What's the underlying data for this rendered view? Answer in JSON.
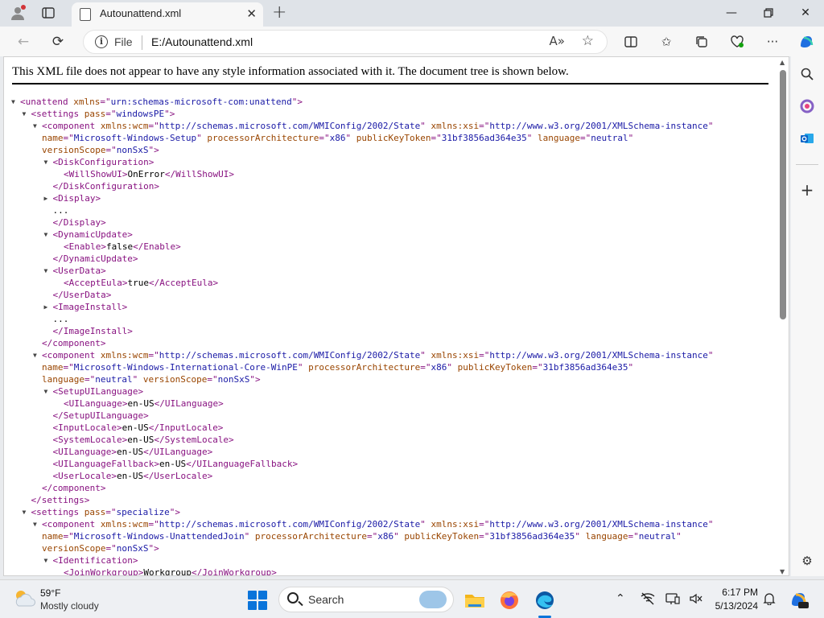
{
  "browser": {
    "tab_title": "Autounattend.xml",
    "address_scheme": "File",
    "address_url": "E:/Autounattend.xml",
    "read_aloud_glyph": "A»"
  },
  "page": {
    "banner": "This XML file does not appear to have any style information associated with it. The document tree is shown below."
  },
  "xml_lines": [
    {
      "indent": 0,
      "toggle": "open",
      "parts": [
        [
          "t",
          "<unattend "
        ],
        [
          "a",
          "xmlns"
        ],
        [
          "t",
          "=\""
        ],
        [
          "v",
          "urn:schemas-microsoft-com:unattend"
        ],
        [
          "t",
          "\">"
        ]
      ]
    },
    {
      "indent": 1,
      "toggle": "open",
      "parts": [
        [
          "t",
          "<settings "
        ],
        [
          "a",
          "pass"
        ],
        [
          "t",
          "=\""
        ],
        [
          "v",
          "windowsPE"
        ],
        [
          "t",
          "\">"
        ]
      ]
    },
    {
      "indent": 2,
      "toggle": "open",
      "parts": [
        [
          "t",
          "<component "
        ],
        [
          "a",
          "xmlns:wcm"
        ],
        [
          "t",
          "=\""
        ],
        [
          "v",
          "http://schemas.microsoft.com/WMIConfig/2002/State"
        ],
        [
          "t",
          "\" "
        ],
        [
          "a",
          "xmlns:xsi"
        ],
        [
          "t",
          "=\""
        ],
        [
          "v",
          "http://www.w3.org/2001/XMLSchema-instance"
        ],
        [
          "t",
          "\""
        ]
      ]
    },
    {
      "indent": 2,
      "cont": true,
      "parts": [
        [
          "a",
          "name"
        ],
        [
          "t",
          "=\""
        ],
        [
          "v",
          "Microsoft-Windows-Setup"
        ],
        [
          "t",
          "\" "
        ],
        [
          "a",
          "processorArchitecture"
        ],
        [
          "t",
          "=\""
        ],
        [
          "v",
          "x86"
        ],
        [
          "t",
          "\" "
        ],
        [
          "a",
          "publicKeyToken"
        ],
        [
          "t",
          "=\""
        ],
        [
          "v",
          "31bf3856ad364e35"
        ],
        [
          "t",
          "\" "
        ],
        [
          "a",
          "language"
        ],
        [
          "t",
          "=\""
        ],
        [
          "v",
          "neutral"
        ],
        [
          "t",
          "\""
        ]
      ]
    },
    {
      "indent": 2,
      "cont": true,
      "parts": [
        [
          "a",
          "versionScope"
        ],
        [
          "t",
          "=\""
        ],
        [
          "v",
          "nonSxS"
        ],
        [
          "t",
          "\">"
        ]
      ]
    },
    {
      "indent": 3,
      "toggle": "open",
      "parts": [
        [
          "t",
          "<DiskConfiguration>"
        ]
      ]
    },
    {
      "indent": 4,
      "parts": [
        [
          "t",
          "<WillShowUI>"
        ],
        [
          "x",
          "OnError"
        ],
        [
          "t",
          "</WillShowUI>"
        ]
      ]
    },
    {
      "indent": 3,
      "parts": [
        [
          "t",
          "</DiskConfiguration>"
        ]
      ]
    },
    {
      "indent": 3,
      "toggle": "closed",
      "parts": [
        [
          "t",
          "<Display>"
        ]
      ]
    },
    {
      "indent": 3,
      "parts": [
        [
          "x",
          "..."
        ]
      ]
    },
    {
      "indent": 3,
      "parts": [
        [
          "t",
          "</Display>"
        ]
      ]
    },
    {
      "indent": 3,
      "toggle": "open",
      "parts": [
        [
          "t",
          "<DynamicUpdate>"
        ]
      ]
    },
    {
      "indent": 4,
      "parts": [
        [
          "t",
          "<Enable>"
        ],
        [
          "x",
          "false"
        ],
        [
          "t",
          "</Enable>"
        ]
      ]
    },
    {
      "indent": 3,
      "parts": [
        [
          "t",
          "</DynamicUpdate>"
        ]
      ]
    },
    {
      "indent": 3,
      "toggle": "open",
      "parts": [
        [
          "t",
          "<UserData>"
        ]
      ]
    },
    {
      "indent": 4,
      "parts": [
        [
          "t",
          "<AcceptEula>"
        ],
        [
          "x",
          "true"
        ],
        [
          "t",
          "</AcceptEula>"
        ]
      ]
    },
    {
      "indent": 3,
      "parts": [
        [
          "t",
          "</UserData>"
        ]
      ]
    },
    {
      "indent": 3,
      "toggle": "closed",
      "parts": [
        [
          "t",
          "<ImageInstall>"
        ]
      ]
    },
    {
      "indent": 3,
      "parts": [
        [
          "x",
          "..."
        ]
      ]
    },
    {
      "indent": 3,
      "parts": [
        [
          "t",
          "</ImageInstall>"
        ]
      ]
    },
    {
      "indent": 2,
      "parts": [
        [
          "t",
          "</component>"
        ]
      ]
    },
    {
      "indent": 2,
      "toggle": "open",
      "parts": [
        [
          "t",
          "<component "
        ],
        [
          "a",
          "xmlns:wcm"
        ],
        [
          "t",
          "=\""
        ],
        [
          "v",
          "http://schemas.microsoft.com/WMIConfig/2002/State"
        ],
        [
          "t",
          "\" "
        ],
        [
          "a",
          "xmlns:xsi"
        ],
        [
          "t",
          "=\""
        ],
        [
          "v",
          "http://www.w3.org/2001/XMLSchema-instance"
        ],
        [
          "t",
          "\""
        ]
      ]
    },
    {
      "indent": 2,
      "cont": true,
      "parts": [
        [
          "a",
          "name"
        ],
        [
          "t",
          "=\""
        ],
        [
          "v",
          "Microsoft-Windows-International-Core-WinPE"
        ],
        [
          "t",
          "\" "
        ],
        [
          "a",
          "processorArchitecture"
        ],
        [
          "t",
          "=\""
        ],
        [
          "v",
          "x86"
        ],
        [
          "t",
          "\" "
        ],
        [
          "a",
          "publicKeyToken"
        ],
        [
          "t",
          "=\""
        ],
        [
          "v",
          "31bf3856ad364e35"
        ],
        [
          "t",
          "\""
        ]
      ]
    },
    {
      "indent": 2,
      "cont": true,
      "parts": [
        [
          "a",
          "language"
        ],
        [
          "t",
          "=\""
        ],
        [
          "v",
          "neutral"
        ],
        [
          "t",
          "\" "
        ],
        [
          "a",
          "versionScope"
        ],
        [
          "t",
          "=\""
        ],
        [
          "v",
          "nonSxS"
        ],
        [
          "t",
          "\">"
        ]
      ]
    },
    {
      "indent": 3,
      "toggle": "open",
      "parts": [
        [
          "t",
          "<SetupUILanguage>"
        ]
      ]
    },
    {
      "indent": 4,
      "parts": [
        [
          "t",
          "<UILanguage>"
        ],
        [
          "x",
          "en-US"
        ],
        [
          "t",
          "</UILanguage>"
        ]
      ]
    },
    {
      "indent": 3,
      "parts": [
        [
          "t",
          "</SetupUILanguage>"
        ]
      ]
    },
    {
      "indent": 3,
      "parts": [
        [
          "t",
          "<InputLocale>"
        ],
        [
          "x",
          "en-US"
        ],
        [
          "t",
          "</InputLocale>"
        ]
      ]
    },
    {
      "indent": 3,
      "parts": [
        [
          "t",
          "<SystemLocale>"
        ],
        [
          "x",
          "en-US"
        ],
        [
          "t",
          "</SystemLocale>"
        ]
      ]
    },
    {
      "indent": 3,
      "parts": [
        [
          "t",
          "<UILanguage>"
        ],
        [
          "x",
          "en-US"
        ],
        [
          "t",
          "</UILanguage>"
        ]
      ]
    },
    {
      "indent": 3,
      "parts": [
        [
          "t",
          "<UILanguageFallback>"
        ],
        [
          "x",
          "en-US"
        ],
        [
          "t",
          "</UILanguageFallback>"
        ]
      ]
    },
    {
      "indent": 3,
      "parts": [
        [
          "t",
          "<UserLocale>"
        ],
        [
          "x",
          "en-US"
        ],
        [
          "t",
          "</UserLocale>"
        ]
      ]
    },
    {
      "indent": 2,
      "parts": [
        [
          "t",
          "</component>"
        ]
      ]
    },
    {
      "indent": 1,
      "parts": [
        [
          "t",
          "</settings>"
        ]
      ]
    },
    {
      "indent": 1,
      "toggle": "open",
      "parts": [
        [
          "t",
          "<settings "
        ],
        [
          "a",
          "pass"
        ],
        [
          "t",
          "=\""
        ],
        [
          "v",
          "specialize"
        ],
        [
          "t",
          "\">"
        ]
      ]
    },
    {
      "indent": 2,
      "toggle": "open",
      "parts": [
        [
          "t",
          "<component "
        ],
        [
          "a",
          "xmlns:wcm"
        ],
        [
          "t",
          "=\""
        ],
        [
          "v",
          "http://schemas.microsoft.com/WMIConfig/2002/State"
        ],
        [
          "t",
          "\" "
        ],
        [
          "a",
          "xmlns:xsi"
        ],
        [
          "t",
          "=\""
        ],
        [
          "v",
          "http://www.w3.org/2001/XMLSchema-instance"
        ],
        [
          "t",
          "\""
        ]
      ]
    },
    {
      "indent": 2,
      "cont": true,
      "parts": [
        [
          "a",
          "name"
        ],
        [
          "t",
          "=\""
        ],
        [
          "v",
          "Microsoft-Windows-UnattendedJoin"
        ],
        [
          "t",
          "\" "
        ],
        [
          "a",
          "processorArchitecture"
        ],
        [
          "t",
          "=\""
        ],
        [
          "v",
          "x86"
        ],
        [
          "t",
          "\" "
        ],
        [
          "a",
          "publicKeyToken"
        ],
        [
          "t",
          "=\""
        ],
        [
          "v",
          "31bf3856ad364e35"
        ],
        [
          "t",
          "\" "
        ],
        [
          "a",
          "language"
        ],
        [
          "t",
          "=\""
        ],
        [
          "v",
          "neutral"
        ],
        [
          "t",
          "\""
        ]
      ]
    },
    {
      "indent": 2,
      "cont": true,
      "parts": [
        [
          "a",
          "versionScope"
        ],
        [
          "t",
          "=\""
        ],
        [
          "v",
          "nonSxS"
        ],
        [
          "t",
          "\">"
        ]
      ]
    },
    {
      "indent": 3,
      "toggle": "open",
      "parts": [
        [
          "t",
          "<Identification>"
        ]
      ]
    },
    {
      "indent": 4,
      "parts": [
        [
          "t",
          "<JoinWorkgroup>"
        ],
        [
          "x",
          "Workgroup"
        ],
        [
          "t",
          "</JoinWorkgroup>"
        ]
      ]
    }
  ],
  "taskbar": {
    "weather_temp": "59°F",
    "weather_desc": "Mostly cloudy",
    "search_label": "Search",
    "time": "6:17 PM",
    "date": "5/13/2024"
  },
  "colors": {
    "tag": "#881280",
    "attr_name": "#994500",
    "attr_value": "#1a1aa6",
    "start_blue": "#0a74da"
  },
  "icons": [
    "profile-icon",
    "tab-actions-icon",
    "file-icon",
    "close-tab-icon",
    "new-tab-icon",
    "minimize-icon",
    "restore-icon",
    "close-window-icon",
    "back-icon",
    "refresh-icon",
    "info-icon",
    "read-aloud-icon",
    "favorite-star-icon",
    "split-screen-icon",
    "favorites-icon",
    "collections-icon",
    "performance-icon",
    "more-icon",
    "copilot-icon",
    "sidebar-search-icon",
    "office-icon",
    "outlook-icon",
    "add-icon",
    "settings-gear-icon",
    "weather-icon",
    "windows-start-icon",
    "search-icon",
    "file-explorer-icon",
    "firefox-icon",
    "edge-icon",
    "chevron-up-icon",
    "network-icon",
    "display-icon",
    "volume-icon",
    "notification-icon",
    "copilot-pre-icon"
  ]
}
